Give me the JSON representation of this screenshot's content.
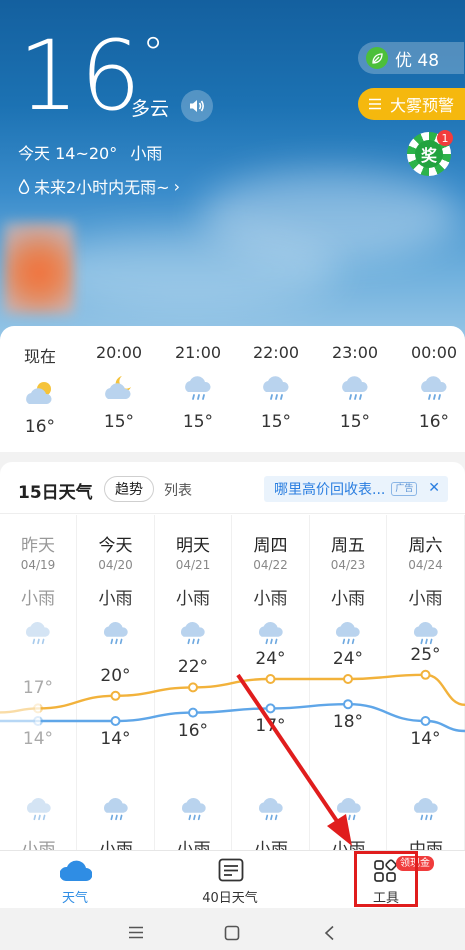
{
  "current": {
    "temperature": "16",
    "degree_symbol": "°",
    "condition": "多云",
    "today_range": "今天 14~20°",
    "today_condition": "小雨",
    "rain_forecast": "未来2小时内无雨~"
  },
  "aqi": {
    "label": "优 48"
  },
  "warning": {
    "label": "大雾预警"
  },
  "prize": {
    "char": "奖",
    "count": "1"
  },
  "hourly": [
    {
      "time": "现在",
      "icon": "partly-cloudy-day-icon",
      "temp": "16°"
    },
    {
      "time": "20:00",
      "icon": "partly-cloudy-night-icon",
      "temp": "15°"
    },
    {
      "time": "21:00",
      "icon": "light-rain-icon",
      "temp": "15°"
    },
    {
      "time": "22:00",
      "icon": "light-rain-icon",
      "temp": "15°"
    },
    {
      "time": "23:00",
      "icon": "light-rain-icon",
      "temp": "15°"
    },
    {
      "time": "00:00",
      "icon": "light-rain-icon",
      "temp": "16°"
    }
  ],
  "forecast": {
    "title": "15日天气",
    "tab_trend": "趋势",
    "tab_list": "列表",
    "ad_text": "哪里高价回收表...",
    "ad_tag": "广告",
    "ad_close": "✕",
    "days": [
      {
        "name": "昨天",
        "date": "04/19",
        "cond": "小雨",
        "night_cond": "小雨",
        "high": "17°",
        "low": "14°"
      },
      {
        "name": "今天",
        "date": "04/20",
        "cond": "小雨",
        "night_cond": "小雨",
        "high": "20°",
        "low": "14°"
      },
      {
        "name": "明天",
        "date": "04/21",
        "cond": "小雨",
        "night_cond": "小雨",
        "high": "22°",
        "low": "16°"
      },
      {
        "name": "周四",
        "date": "04/22",
        "cond": "小雨",
        "night_cond": "小雨",
        "high": "24°",
        "low": "17°"
      },
      {
        "name": "周五",
        "date": "04/23",
        "cond": "小雨",
        "night_cond": "小雨",
        "high": "24°",
        "low": "18°"
      },
      {
        "name": "周六",
        "date": "04/24",
        "cond": "小雨",
        "night_cond": "中雨",
        "high": "25°",
        "low": "14°"
      }
    ]
  },
  "chart_data": {
    "type": "line",
    "categories": [
      "04/19",
      "04/20",
      "04/21",
      "04/22",
      "04/23",
      "04/24"
    ],
    "series": [
      {
        "values": [
          17,
          20,
          22,
          24,
          24,
          25
        ]
      },
      {
        "values": [
          14,
          14,
          16,
          17,
          18,
          14
        ]
      }
    ]
  },
  "tabbar": {
    "weather": "天气",
    "forty_day": "40日天气",
    "tools": "工具",
    "tools_badge": "领现金"
  },
  "colors": {
    "high_line": "#f2b23b",
    "low_line": "#5fa6e8",
    "active_tab": "#2f8de4",
    "annotation": "#e01d1d"
  }
}
